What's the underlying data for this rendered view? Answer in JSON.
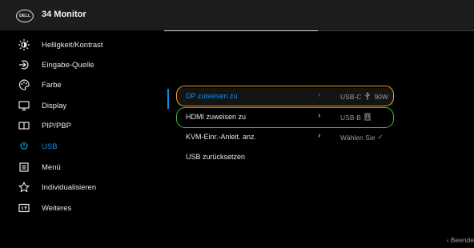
{
  "header": {
    "logo_text": "DELL",
    "title": "34 Monitor"
  },
  "sidebar": {
    "items": [
      {
        "label": "Helligkeit/Kontrast",
        "icon": "brightness-icon"
      },
      {
        "label": "Eingabe-Quelle",
        "icon": "input-source-icon"
      },
      {
        "label": "Farbe",
        "icon": "color-palette-icon"
      },
      {
        "label": "Display",
        "icon": "display-icon"
      },
      {
        "label": "PIP/PBP",
        "icon": "pip-pbp-icon"
      },
      {
        "label": "USB",
        "icon": "usb-icon",
        "active": true
      },
      {
        "label": "Menü",
        "icon": "menu-icon"
      },
      {
        "label": "Individualisieren",
        "icon": "star-icon"
      },
      {
        "label": "Weiteres",
        "icon": "others-icon"
      }
    ]
  },
  "main": {
    "rows": [
      {
        "label": "DP zuweisen zu",
        "chevron": "›",
        "value": "USB-C",
        "value_suffix": "90W",
        "selected": true
      },
      {
        "label": "HDMI zuweisen zu",
        "chevron": "›",
        "value": "USB-B"
      },
      {
        "label": "KVM-Einr.-Anleit. anz.",
        "chevron": "›",
        "value": "Wählen Sie",
        "value_suffix": "✓"
      },
      {
        "label": "USB zurücksetzen"
      }
    ]
  },
  "footer": {
    "exit_label": "‹ Beende"
  },
  "colors": {
    "accent": "#0a8fe6",
    "ring_orange": "#f39a1e",
    "ring_green": "#3fb54a"
  }
}
